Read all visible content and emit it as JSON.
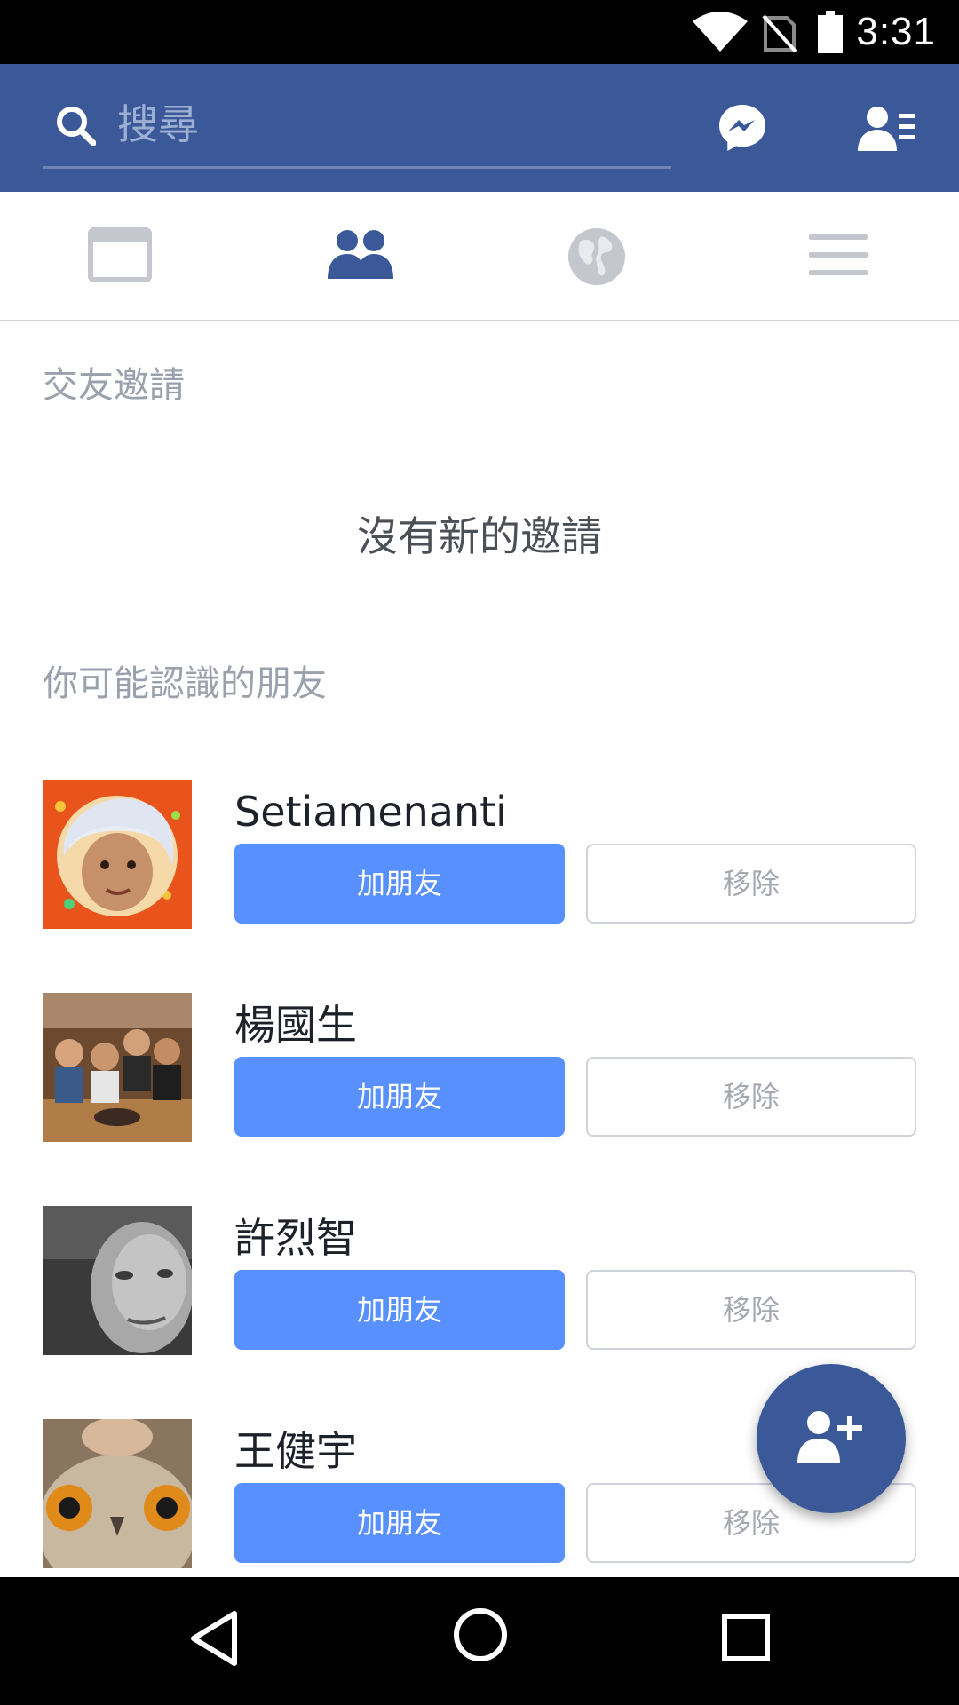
{
  "status_bar": {
    "time": "3:31",
    "icons": [
      "wifi-icon",
      "no-sim-icon",
      "battery-icon"
    ]
  },
  "header": {
    "search_placeholder": "搜尋",
    "icons": [
      "search-icon",
      "messenger-icon",
      "friends-list-icon"
    ]
  },
  "tabs": [
    {
      "name": "news-feed",
      "icon": "news-feed-icon",
      "active": false
    },
    {
      "name": "friend-requests",
      "icon": "friends-icon",
      "active": true
    },
    {
      "name": "notifications",
      "icon": "globe-icon",
      "active": false
    },
    {
      "name": "menu",
      "icon": "menu-icon",
      "active": false
    }
  ],
  "friend_requests": {
    "title": "交友邀請",
    "empty_text": "沒有新的邀請"
  },
  "people_you_may_know": {
    "title": "你可能認識的朋友",
    "people": [
      {
        "name": "Setiamenanti",
        "add_label": "加朋友",
        "remove_label": "移除"
      },
      {
        "name": "楊國生",
        "add_label": "加朋友",
        "remove_label": "移除"
      },
      {
        "name": "許烈智",
        "add_label": "加朋友",
        "remove_label": "移除"
      },
      {
        "name": "王健宇",
        "add_label": "加朋友",
        "remove_label": "移除"
      }
    ]
  },
  "fab": {
    "icon": "add-friend-icon"
  },
  "navbar": {
    "icons": [
      "back-icon",
      "home-icon",
      "recents-icon"
    ]
  },
  "colors": {
    "brand_blue": "#3b5998",
    "button_blue": "#5890ff",
    "text_dark": "#1d2129",
    "text_muted": "#9aa1ad"
  }
}
